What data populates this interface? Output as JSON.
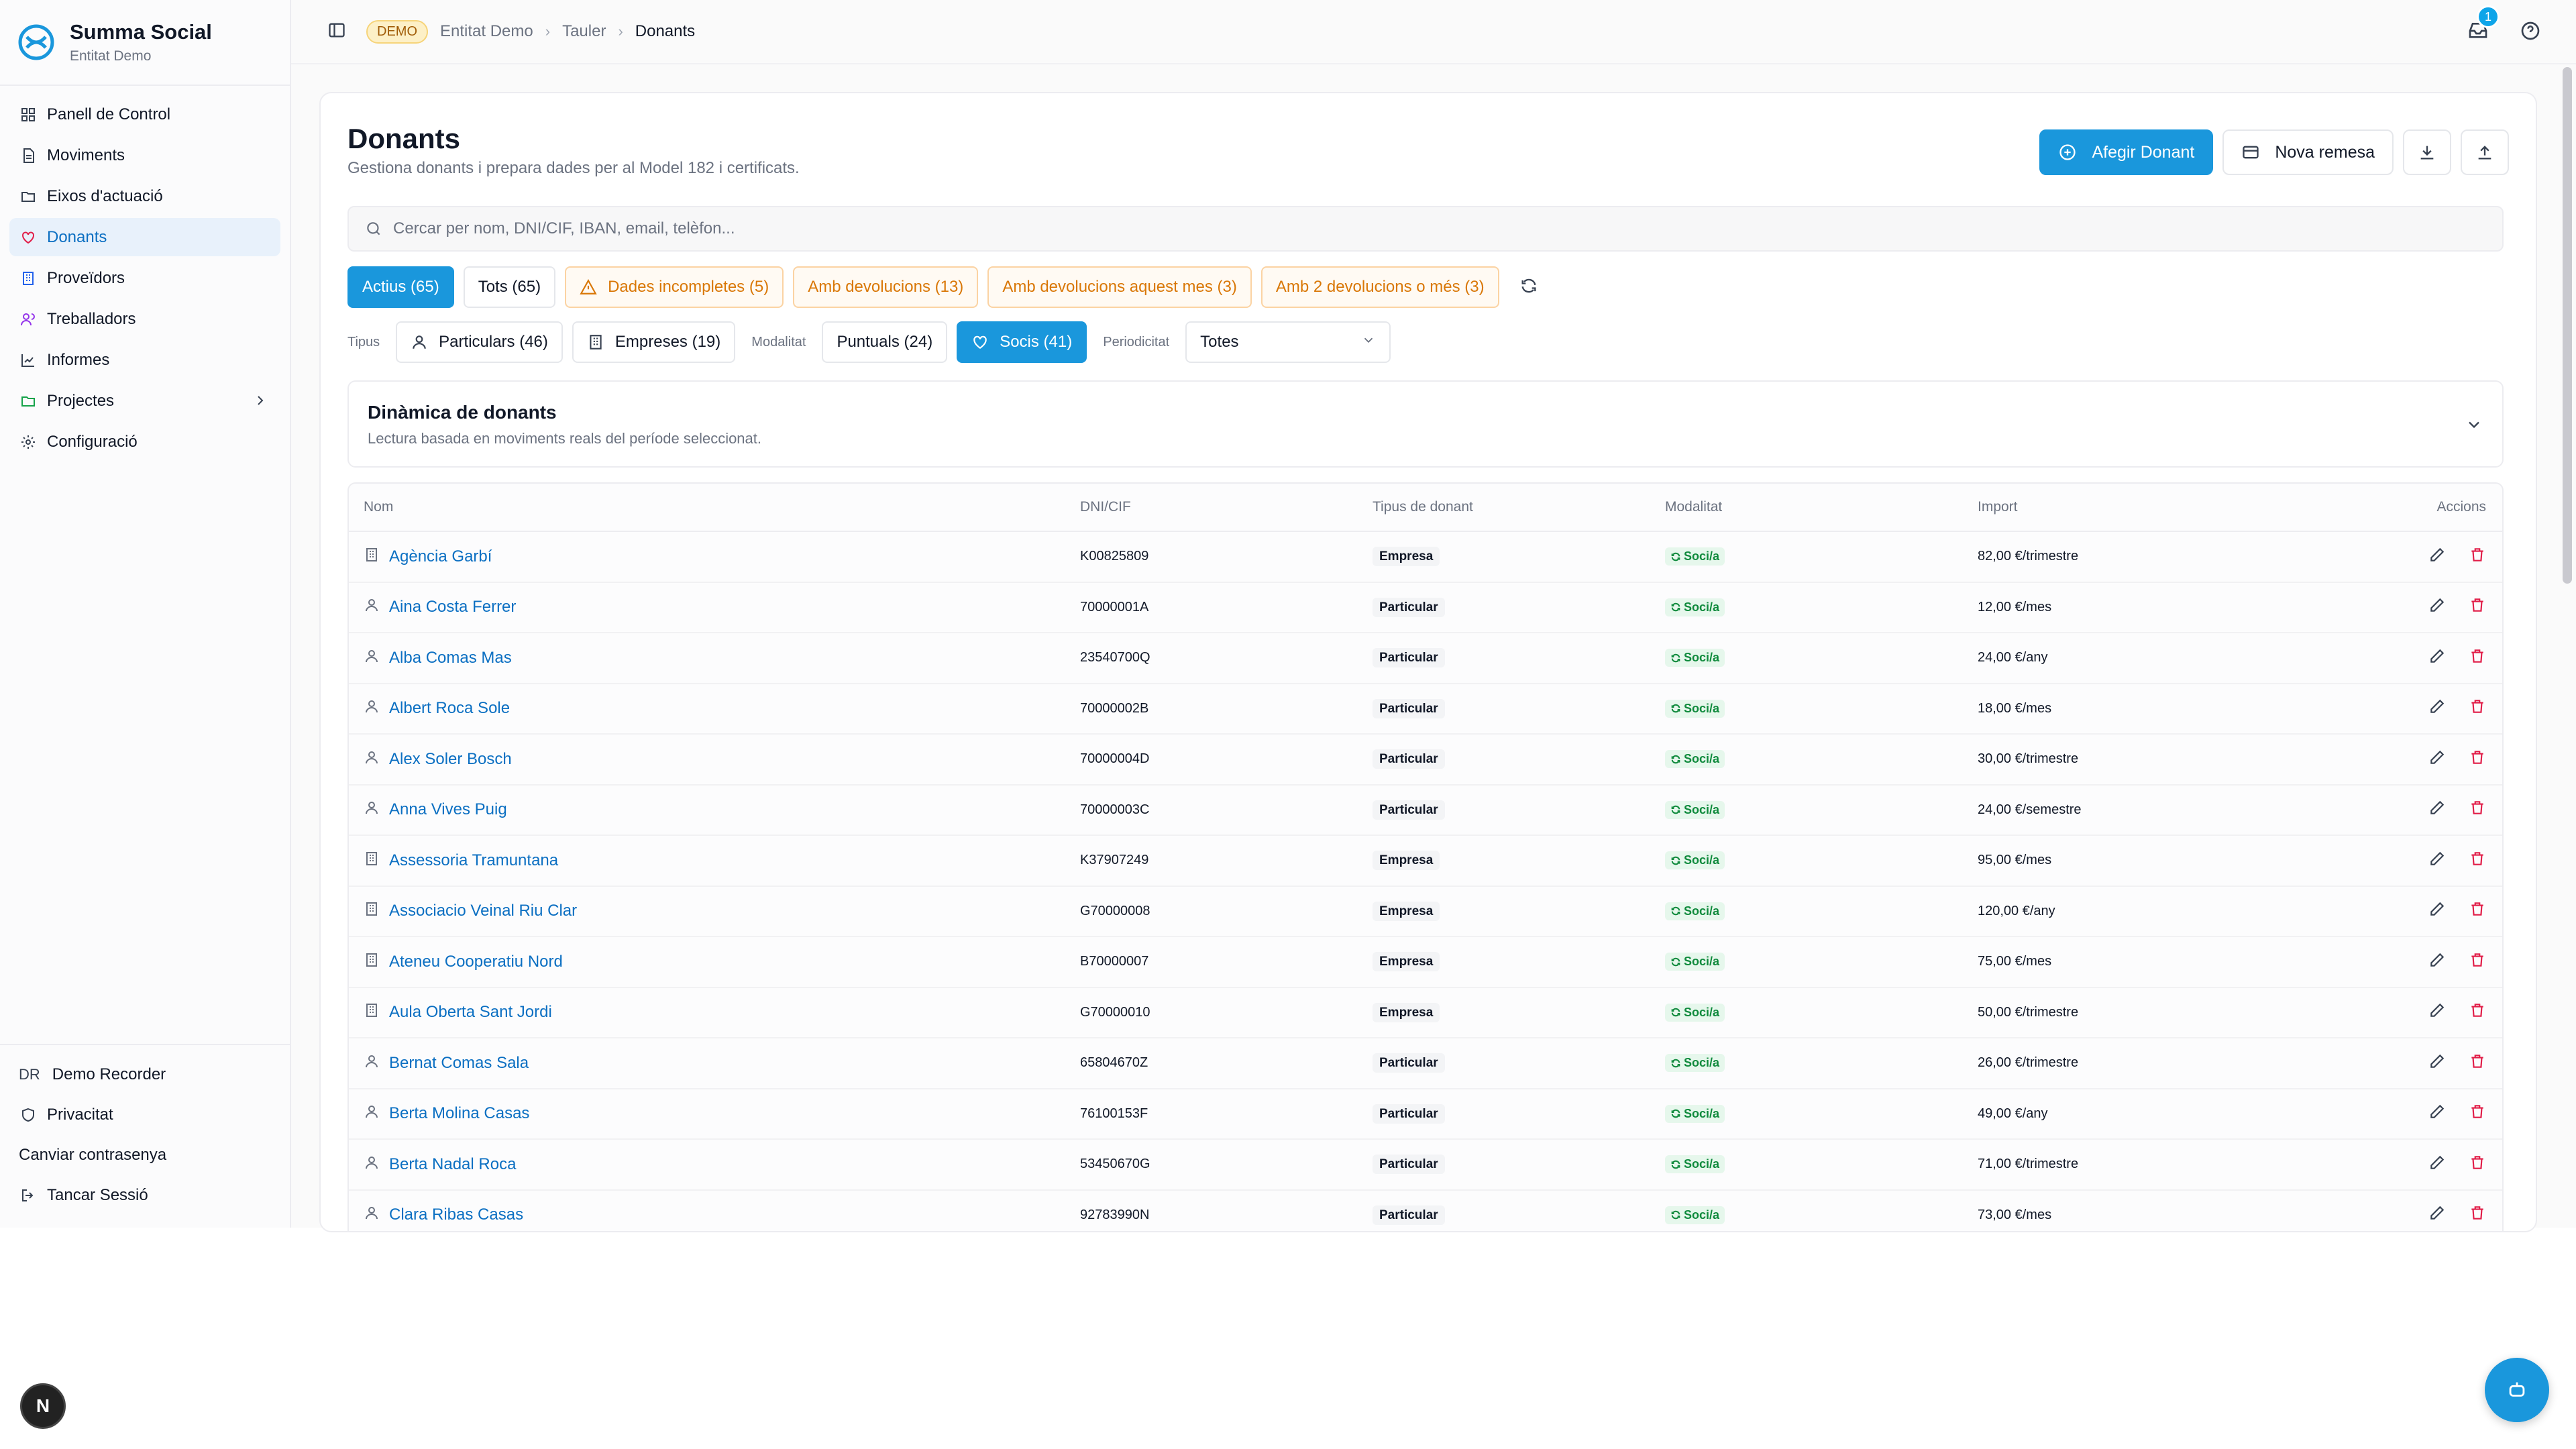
{
  "app": {
    "name": "Summa Social",
    "entity": "Entitat Demo"
  },
  "sidebar": {
    "items": [
      {
        "label": "Panell de Control",
        "icon": "dashboard-icon"
      },
      {
        "label": "Moviments",
        "icon": "document-icon"
      },
      {
        "label": "Eixos d'actuació",
        "icon": "folder-icon"
      },
      {
        "label": "Donants",
        "icon": "heart-icon"
      },
      {
        "label": "Proveïdors",
        "icon": "building-icon"
      },
      {
        "label": "Treballadors",
        "icon": "users-icon"
      },
      {
        "label": "Informes",
        "icon": "chart-icon"
      },
      {
        "label": "Projectes",
        "icon": "folder-icon"
      },
      {
        "label": "Configuració",
        "icon": "gear-icon"
      }
    ],
    "footer": {
      "user_initials": "DR",
      "user_name": "Demo Recorder",
      "privacy": "Privacitat",
      "change_password": "Canviar contrasenya",
      "logout": "Tancar Sessió"
    }
  },
  "topbar": {
    "badge": "DEMO",
    "breadcrumb": [
      "Entitat Demo",
      "Tauler",
      "Donants"
    ],
    "notif_count": "1"
  },
  "page": {
    "title": "Donants",
    "subtitle": "Gestiona donants i prepara dades per al Model 182 i certificats.",
    "add_button": "Afegir Donant",
    "remesa_button": "Nova remesa",
    "search_placeholder": "Cercar per nom, DNI/CIF, IBAN, email, telèfon..."
  },
  "chips": [
    "Actius (65)",
    "Tots (65)",
    "Dades incompletes (5)",
    "Amb devolucions (13)",
    "Amb devolucions aquest mes (3)",
    "Amb 2 devolucions o més (3)"
  ],
  "filters": {
    "tipus_label": "Tipus",
    "particulars": "Particulars (46)",
    "empreses": "Empreses (19)",
    "modalitat_label": "Modalitat",
    "puntuals": "Puntuals (24)",
    "socis": "Socis (41)",
    "periodicitat_label": "Periodicitat",
    "periodicitat_value": "Totes"
  },
  "dynamics": {
    "title": "Dinàmica de donants",
    "subtitle": "Lectura basada en moviments reals del període seleccionat."
  },
  "table": {
    "headers": [
      "Nom",
      "DNI/CIF",
      "Tipus de donant",
      "Modalitat",
      "Import",
      "Accions"
    ],
    "rows": [
      {
        "name": "Agència Garbí",
        "dni": "K00825809",
        "type": "Empresa",
        "mod": "Soci/a",
        "import": "82,00 €/trimestre"
      },
      {
        "name": "Aina Costa Ferrer",
        "dni": "70000001A",
        "type": "Particular",
        "mod": "Soci/a",
        "import": "12,00 €/mes"
      },
      {
        "name": "Alba Comas Mas",
        "dni": "23540700Q",
        "type": "Particular",
        "mod": "Soci/a",
        "import": "24,00 €/any"
      },
      {
        "name": "Albert Roca Sole",
        "dni": "70000002B",
        "type": "Particular",
        "mod": "Soci/a",
        "import": "18,00 €/mes"
      },
      {
        "name": "Alex Soler Bosch",
        "dni": "70000004D",
        "type": "Particular",
        "mod": "Soci/a",
        "import": "30,00 €/trimestre"
      },
      {
        "name": "Anna Vives Puig",
        "dni": "70000003C",
        "type": "Particular",
        "mod": "Soci/a",
        "import": "24,00 €/semestre"
      },
      {
        "name": "Assessoria Tramuntana",
        "dni": "K37907249",
        "type": "Empresa",
        "mod": "Soci/a",
        "import": "95,00 €/mes"
      },
      {
        "name": "Associacio Veinal Riu Clar",
        "dni": "G70000008",
        "type": "Empresa",
        "mod": "Soci/a",
        "import": "120,00 €/any"
      },
      {
        "name": "Ateneu Cooperatiu Nord",
        "dni": "B70000007",
        "type": "Empresa",
        "mod": "Soci/a",
        "import": "75,00 €/mes"
      },
      {
        "name": "Aula Oberta Sant Jordi",
        "dni": "G70000010",
        "type": "Empresa",
        "mod": "Soci/a",
        "import": "50,00 €/trimestre"
      },
      {
        "name": "Bernat Comas Sala",
        "dni": "65804670Z",
        "type": "Particular",
        "mod": "Soci/a",
        "import": "26,00 €/trimestre"
      },
      {
        "name": "Berta Molina Casas",
        "dni": "76100153F",
        "type": "Particular",
        "mod": "Soci/a",
        "import": "49,00 €/any"
      },
      {
        "name": "Berta Nadal Roca",
        "dni": "53450670G",
        "type": "Particular",
        "mod": "Soci/a",
        "import": "71,00 €/trimestre"
      },
      {
        "name": "Clara Ribas Casas",
        "dni": "92783990N",
        "type": "Particular",
        "mod": "Soci/a",
        "import": "73,00 €/mes"
      }
    ]
  },
  "misc": {
    "fab_label": "",
    "n_button": "N"
  }
}
